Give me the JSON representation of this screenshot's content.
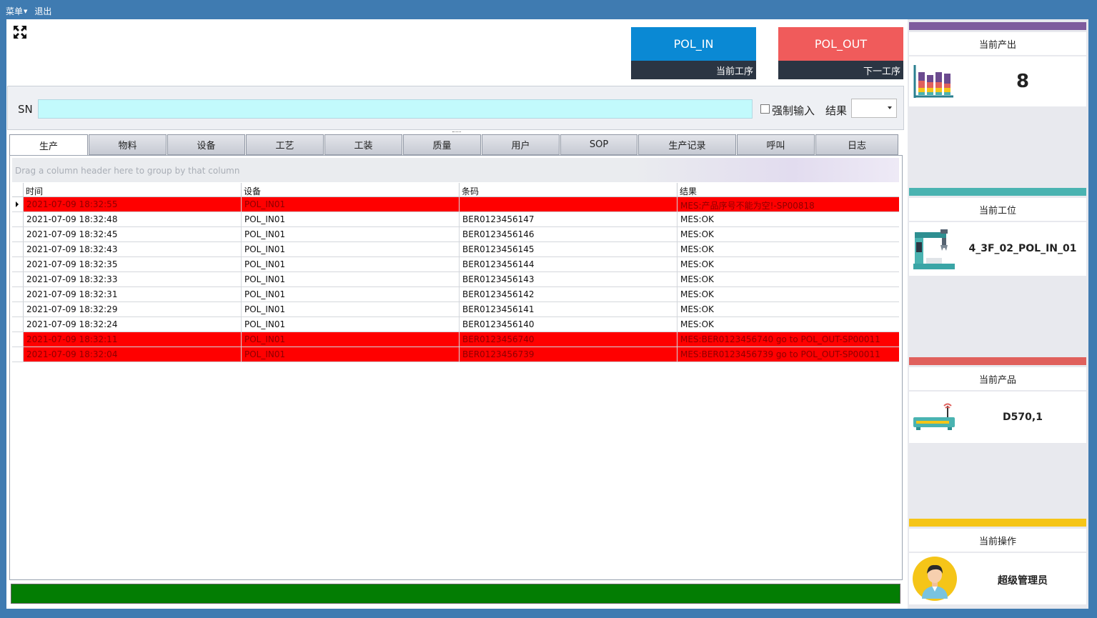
{
  "menu": {
    "menu_label": "菜单",
    "exit_label": "退出"
  },
  "steps": {
    "current": {
      "name": "POL_IN",
      "caption": "当前工序"
    },
    "next": {
      "name": "POL_OUT",
      "caption": "下一工序"
    }
  },
  "sn": {
    "label": "SN",
    "value": "",
    "force_label": "强制输入",
    "result_label": "结果",
    "result_value": ""
  },
  "tabs": [
    {
      "label": "生产"
    },
    {
      "label": "物料"
    },
    {
      "label": "设备"
    },
    {
      "label": "工艺"
    },
    {
      "label": "工装"
    },
    {
      "label": "质量"
    },
    {
      "label": "用户"
    },
    {
      "label": "SOP"
    },
    {
      "label": "生产记录"
    },
    {
      "label": "呼叫"
    },
    {
      "label": "日志"
    }
  ],
  "grid": {
    "group_hint": "Drag a column header here to group by that column",
    "columns": [
      "时间",
      "设备",
      "条码",
      "结果"
    ],
    "rows": [
      {
        "time": "2021-07-09 18:32:55",
        "device": "POL_IN01",
        "barcode": "",
        "result": "MES:产品序号不能为空!-SP00818",
        "error": true,
        "current": true
      },
      {
        "time": "2021-07-09 18:32:48",
        "device": "POL_IN01",
        "barcode": "BER0123456147",
        "result": "MES:OK",
        "error": false,
        "current": false
      },
      {
        "time": "2021-07-09 18:32:45",
        "device": "POL_IN01",
        "barcode": "BER0123456146",
        "result": "MES:OK",
        "error": false,
        "current": false
      },
      {
        "time": "2021-07-09 18:32:43",
        "device": "POL_IN01",
        "barcode": "BER0123456145",
        "result": "MES:OK",
        "error": false,
        "current": false
      },
      {
        "time": "2021-07-09 18:32:35",
        "device": "POL_IN01",
        "barcode": "BER0123456144",
        "result": "MES:OK",
        "error": false,
        "current": false
      },
      {
        "time": "2021-07-09 18:32:33",
        "device": "POL_IN01",
        "barcode": "BER0123456143",
        "result": "MES:OK",
        "error": false,
        "current": false
      },
      {
        "time": "2021-07-09 18:32:31",
        "device": "POL_IN01",
        "barcode": "BER0123456142",
        "result": "MES:OK",
        "error": false,
        "current": false
      },
      {
        "time": "2021-07-09 18:32:29",
        "device": "POL_IN01",
        "barcode": "BER0123456141",
        "result": "MES:OK",
        "error": false,
        "current": false
      },
      {
        "time": "2021-07-09 18:32:24",
        "device": "POL_IN01",
        "barcode": "BER0123456140",
        "result": "MES:OK",
        "error": false,
        "current": false
      },
      {
        "time": "2021-07-09 18:32:11",
        "device": "POL_IN01",
        "barcode": "BER0123456740",
        "result": "MES:BER0123456740 go to POL_OUT-SP00011",
        "error": true,
        "current": false
      },
      {
        "time": "2021-07-09 18:32:04",
        "device": "POL_IN01",
        "barcode": "BER0123456739",
        "result": "MES:BER0123456739 go to POL_OUT-SP00011",
        "error": true,
        "current": false
      }
    ]
  },
  "side": {
    "output": {
      "title": "当前产出",
      "value": "8",
      "icon": "bar-chart-icon",
      "color": "#7e5b9d"
    },
    "station": {
      "title": "当前工位",
      "value": "4_3F_02_POL_IN_01",
      "icon": "machine-icon",
      "color": "#4ab3b1"
    },
    "product": {
      "title": "当前产品",
      "value": "D570,1",
      "icon": "router-icon",
      "color": "#e0605c"
    },
    "operator": {
      "title": "当前操作",
      "value": "超级管理员",
      "icon": "user-avatar-icon",
      "color": "#f5c518"
    }
  },
  "colors": {
    "error_row": "#ff0000",
    "status_ok": "#037d03",
    "step_in": "#0a89d4",
    "step_out": "#f05b5b"
  }
}
